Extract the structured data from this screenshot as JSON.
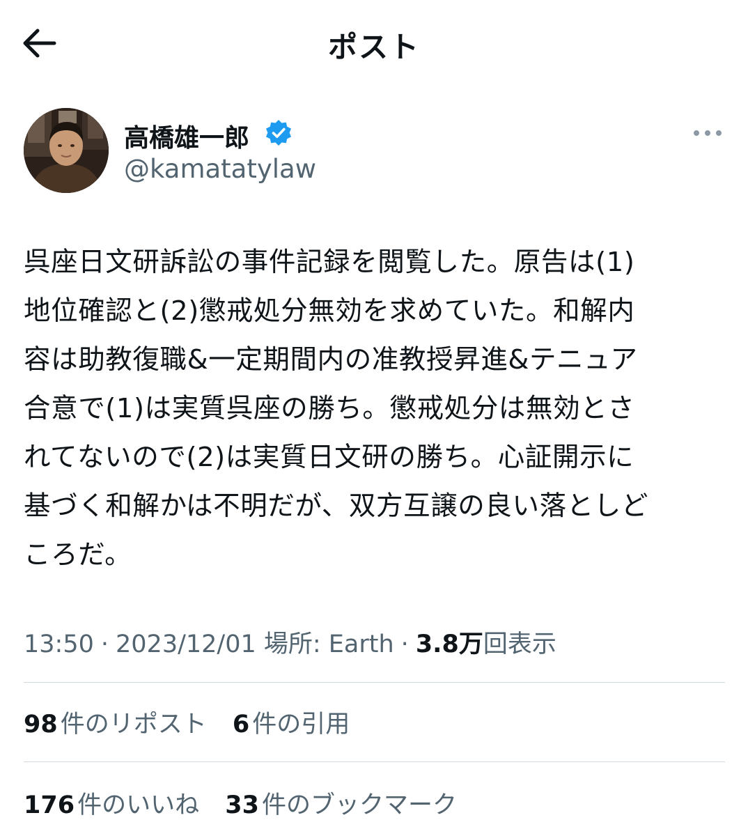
{
  "header": {
    "title": "ポスト",
    "back_icon": "arrow-left-icon"
  },
  "author": {
    "display_name": "高橋雄一郎",
    "handle": "@kamatatylaw",
    "verified_icon": "verified-badge-icon",
    "more_icon": "more-horizontal-icon",
    "verified_color": "#1d9bf0"
  },
  "post": {
    "text": "呉座日文研訴訟の事件記録を閲覧した。原告は(1)\n地位確認と(2)懲戒処分無効を求めていた。和解内\n容は助教復職&一定期間内の准教授昇進&テニュア\n合意で(1)は実質呉座の勝ち。懲戒処分は無効とさ\nれてないので(2)は実質日文研の勝ち。心証開示に\n基づく和解かは不明だが、双方互譲の良い落としど\nころだ。"
  },
  "meta": {
    "time": "13:50",
    "date": "2023/12/01",
    "location_label": "場所: Earth",
    "views_count": "3.8万",
    "views_label": "回表示",
    "separator": "·"
  },
  "stats": {
    "reposts_count": "98",
    "reposts_label": "件のリポスト",
    "quotes_count": "6",
    "quotes_label": "件の引用",
    "likes_count": "176",
    "likes_label": "件のいいね",
    "bookmarks_count": "33",
    "bookmarks_label": "件のブックマーク"
  }
}
